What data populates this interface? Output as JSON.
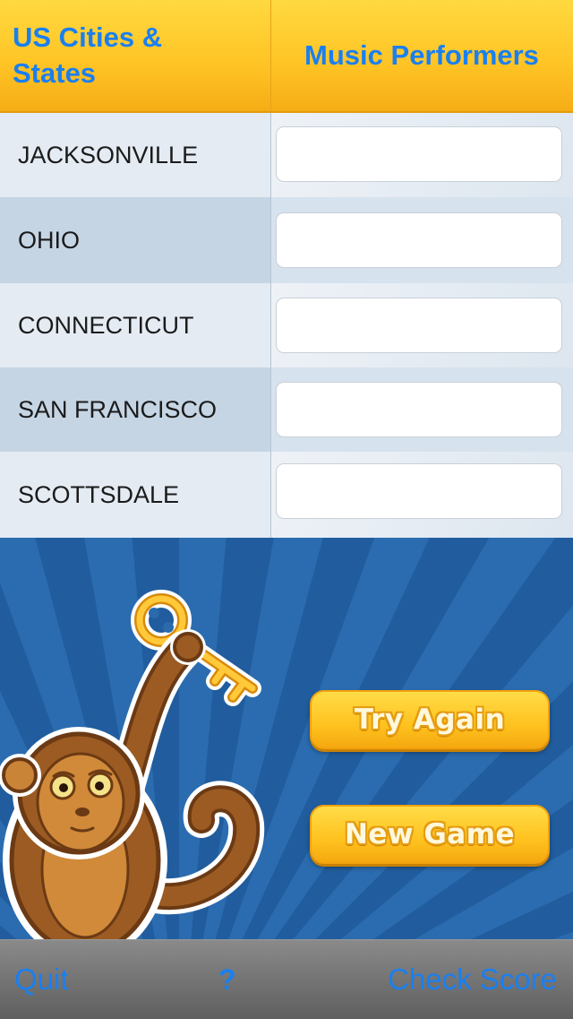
{
  "header": {
    "left_title": "US Cities & States",
    "right_title": "Music Performers"
  },
  "rows": [
    {
      "label": "JACKSONVILLE",
      "answer": ""
    },
    {
      "label": "OHIO",
      "answer": ""
    },
    {
      "label": "CONNECTICUT",
      "answer": ""
    },
    {
      "label": "SAN FRANCISCO",
      "answer": ""
    },
    {
      "label": "SCOTTSDALE",
      "answer": ""
    }
  ],
  "buttons": {
    "try_again": "Try Again",
    "new_game": "New Game"
  },
  "toolbar": {
    "quit": "Quit",
    "help": "?",
    "check_score": "Check Score"
  },
  "colors": {
    "accent_blue": "#1a7ff0",
    "header_yellow": "#ffc526",
    "stage_blue": "#2b6cb0"
  }
}
